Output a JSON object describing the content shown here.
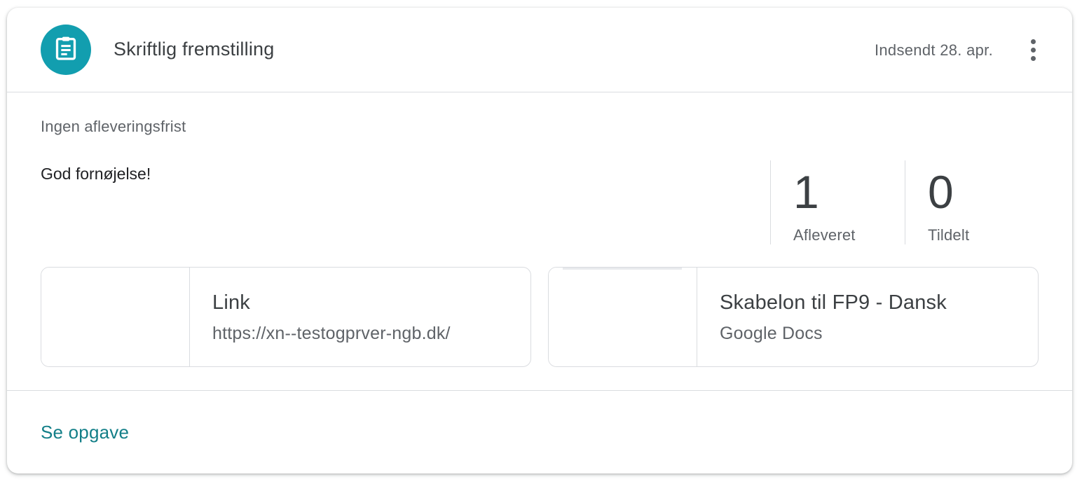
{
  "header": {
    "title": "Skriftlig fremstilling",
    "submitted": "Indsendt 28. apr.",
    "icon": "assignment-icon",
    "avatar_color": "#129eaf"
  },
  "body": {
    "deadline": "Ingen afleveringsfrist",
    "description": "God fornøjelse!"
  },
  "stats": [
    {
      "value": "1",
      "label": "Afleveret"
    },
    {
      "value": "0",
      "label": "Tildelt"
    }
  ],
  "attachments": [
    {
      "title": "Link",
      "subtitle": "https://xn--testogprver-ngb.dk/"
    },
    {
      "title": "Skabelon til FP9 - Dansk",
      "subtitle": "Google Docs"
    }
  ],
  "footer": {
    "view_label": "Se opgave",
    "link_color": "#137f88"
  }
}
